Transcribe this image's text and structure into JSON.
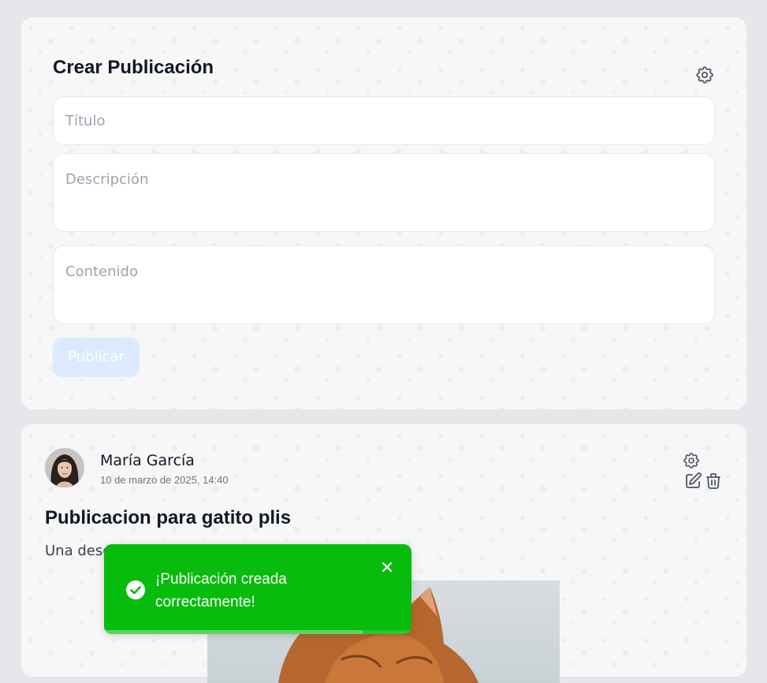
{
  "create_post": {
    "title": "Crear Publicación",
    "title_placeholder": "Título",
    "description_placeholder": "Descripción",
    "content_placeholder": "Contenido",
    "publish_label": "Publicar",
    "settings_icon": "gear-icon"
  },
  "post": {
    "author": "María García",
    "date": "10 de marzo de 2025, 14:40",
    "title": "Publicacion para gatito plis",
    "description": "Una desc",
    "icons": [
      "gear-icon",
      "edit-icon",
      "trash-icon"
    ]
  },
  "toast": {
    "message": "¡Publicación creada correctamente!",
    "icon": "check-circle-icon",
    "close_icon": "close-icon",
    "progress": 0.84,
    "color": "#07bc0c"
  }
}
